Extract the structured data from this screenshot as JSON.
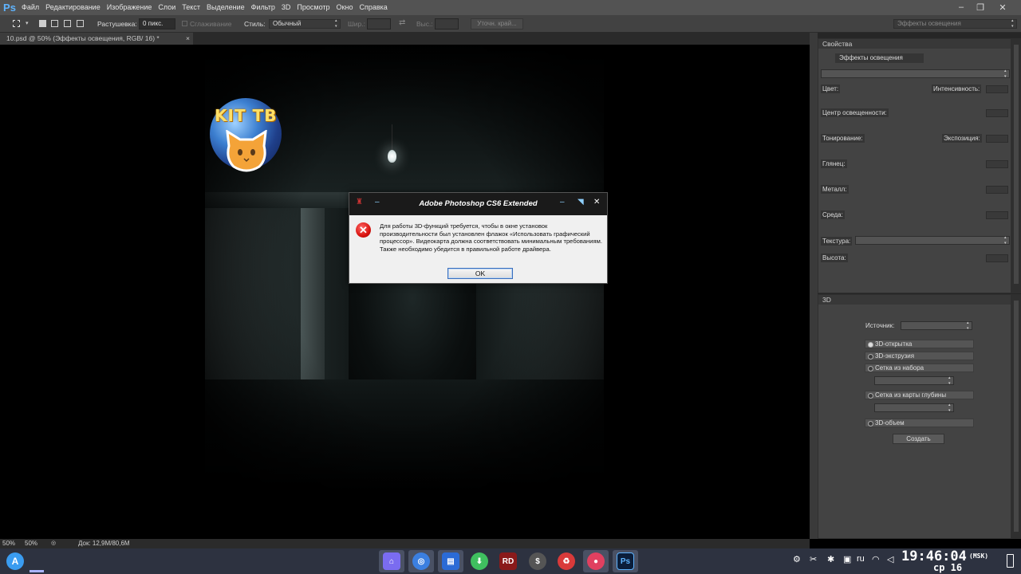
{
  "app": {
    "logo": "Ps",
    "menu": [
      "Файл",
      "Редактирование",
      "Изображение",
      "Слои",
      "Текст",
      "Выделение",
      "Фильтр",
      "3D",
      "Просмотр",
      "Окно",
      "Справка"
    ],
    "workspace": "Эффекты освещения"
  },
  "options": {
    "feather_label": "Растушевка:",
    "feather_value": "0 пикс.",
    "antialias_label": "Сглаживание",
    "style_label": "Стиль:",
    "style_value": "Обычный",
    "width_label": "Шир.:",
    "height_label": "Выс.:",
    "refine_label": "Уточн. край..."
  },
  "document": {
    "tab_label": "10.psd @ 50% (Эффекты освещения, RGB/ 16) *",
    "close": "×"
  },
  "logo": {
    "text": "KIT TB"
  },
  "properties": {
    "header": "Свойства",
    "preset": "Эффекты освещения",
    "color_label": "Цвет:",
    "intensity_label": "Интенсивность:",
    "center_label": "Центр освещенности:",
    "tone_label": "Тонирование:",
    "exposure_label": "Экспозиция:",
    "gloss_label": "Глянец:",
    "metal_label": "Металл:",
    "ambient_label": "Среда:",
    "texture_label": "Текстура:",
    "height_label": "Высота:"
  },
  "panel3d": {
    "header": "3D",
    "source_label": "Источник:",
    "options": [
      "3D-открытка",
      "3D-экструзия",
      "Сетка из набора",
      "Сетка из карты глубины",
      "3D-объем"
    ],
    "create": "Создать"
  },
  "dialog": {
    "title": "Adobe Photoshop CS6 Extended",
    "message": "Для работы 3D-функций требуется, чтобы в окне установок производительности был установлен флажок «Использовать графический процессор». Видеокарта должна соответствовать минимальным требованиям. Также необходимо убедится в правильной работе драйвера.",
    "ok": "OK"
  },
  "status": {
    "zoom": "50%",
    "doc": "Док: 12,9M/80,6M"
  },
  "taskbar": {
    "lang": "ru",
    "time": "19:46:04",
    "tz": "(MSK)",
    "day": "ср 16"
  },
  "colors": {
    "accent_ps": "#5fb4ff",
    "error_red": "#d9140f",
    "ok_border": "#3a6fbd"
  }
}
